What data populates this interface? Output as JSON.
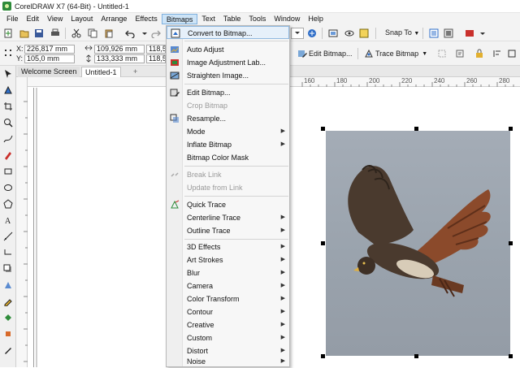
{
  "window": {
    "title": "CorelDRAW X7 (64-Bit) - Untitled-1"
  },
  "menubar": {
    "items": [
      "File",
      "Edit",
      "View",
      "Layout",
      "Arrange",
      "Effects",
      "Bitmaps",
      "Text",
      "Table",
      "Tools",
      "Window",
      "Help"
    ],
    "active": "Bitmaps"
  },
  "toolbar": {
    "snap_label": "Snap To"
  },
  "property_bar": {
    "x_label": "X:",
    "y_label": "Y:",
    "x_value": "226,817 mm",
    "y_value": "105,0 mm",
    "width_value": "109,926 mm",
    "height_value": "133,333 mm",
    "scale_x": "118,5",
    "scale_y": "118,5",
    "edit_bitmap": "Edit Bitmap...",
    "trace_bitmap": "Trace Bitmap"
  },
  "tabs": {
    "welcome": "Welcome Screen",
    "document": "Untitled-1",
    "add": "+"
  },
  "ruler": {
    "h_labels": [
      "160",
      "180",
      "200",
      "220",
      "240",
      "260",
      "280"
    ]
  },
  "bitmaps_menu": {
    "items": [
      {
        "label": "Convert to Bitmap...",
        "enabled": true,
        "submenu": false,
        "icon": "convert-bitmap-icon"
      },
      {
        "label": "Auto Adjust",
        "enabled": true,
        "submenu": false,
        "icon": "auto-adjust-icon"
      },
      {
        "label": "Image Adjustment Lab...",
        "enabled": true,
        "submenu": false,
        "icon": "adjustment-lab-icon"
      },
      {
        "label": "Straighten Image...",
        "enabled": true,
        "submenu": false,
        "icon": "straighten-icon"
      },
      {
        "label": "Edit Bitmap...",
        "enabled": true,
        "submenu": false,
        "icon": "edit-bitmap-icon"
      },
      {
        "label": "Crop Bitmap",
        "enabled": false,
        "submenu": false,
        "icon": ""
      },
      {
        "label": "Resample...",
        "enabled": true,
        "submenu": false,
        "icon": "resample-icon"
      },
      {
        "label": "Mode",
        "enabled": true,
        "submenu": true,
        "icon": ""
      },
      {
        "label": "Inflate Bitmap",
        "enabled": true,
        "submenu": true,
        "icon": ""
      },
      {
        "label": "Bitmap Color Mask",
        "enabled": true,
        "submenu": false,
        "icon": ""
      },
      {
        "label": "Break Link",
        "enabled": false,
        "submenu": false,
        "icon": "break-link-icon"
      },
      {
        "label": "Update from Link",
        "enabled": false,
        "submenu": false,
        "icon": ""
      },
      {
        "label": "Quick Trace",
        "enabled": true,
        "submenu": false,
        "icon": "quick-trace-icon"
      },
      {
        "label": "Centerline Trace",
        "enabled": true,
        "submenu": true,
        "icon": ""
      },
      {
        "label": "Outline Trace",
        "enabled": true,
        "submenu": true,
        "icon": ""
      },
      {
        "label": "3D Effects",
        "enabled": true,
        "submenu": true,
        "icon": ""
      },
      {
        "label": "Art Strokes",
        "enabled": true,
        "submenu": true,
        "icon": ""
      },
      {
        "label": "Blur",
        "enabled": true,
        "submenu": true,
        "icon": ""
      },
      {
        "label": "Camera",
        "enabled": true,
        "submenu": true,
        "icon": ""
      },
      {
        "label": "Color Transform",
        "enabled": true,
        "submenu": true,
        "icon": ""
      },
      {
        "label": "Contour",
        "enabled": true,
        "submenu": true,
        "icon": ""
      },
      {
        "label": "Creative",
        "enabled": true,
        "submenu": true,
        "icon": ""
      },
      {
        "label": "Custom",
        "enabled": true,
        "submenu": true,
        "icon": ""
      },
      {
        "label": "Distort",
        "enabled": true,
        "submenu": true,
        "icon": ""
      },
      {
        "label": "Noise",
        "enabled": true,
        "submenu": true,
        "icon": ""
      }
    ]
  },
  "colors": {
    "menu_highlight": "#cde4f7",
    "accent": "#2e6ec8",
    "bitmap_bg": "#9ca4ae",
    "bird_body": "#4a3a2e",
    "bird_wing": "#8b4a2b"
  }
}
